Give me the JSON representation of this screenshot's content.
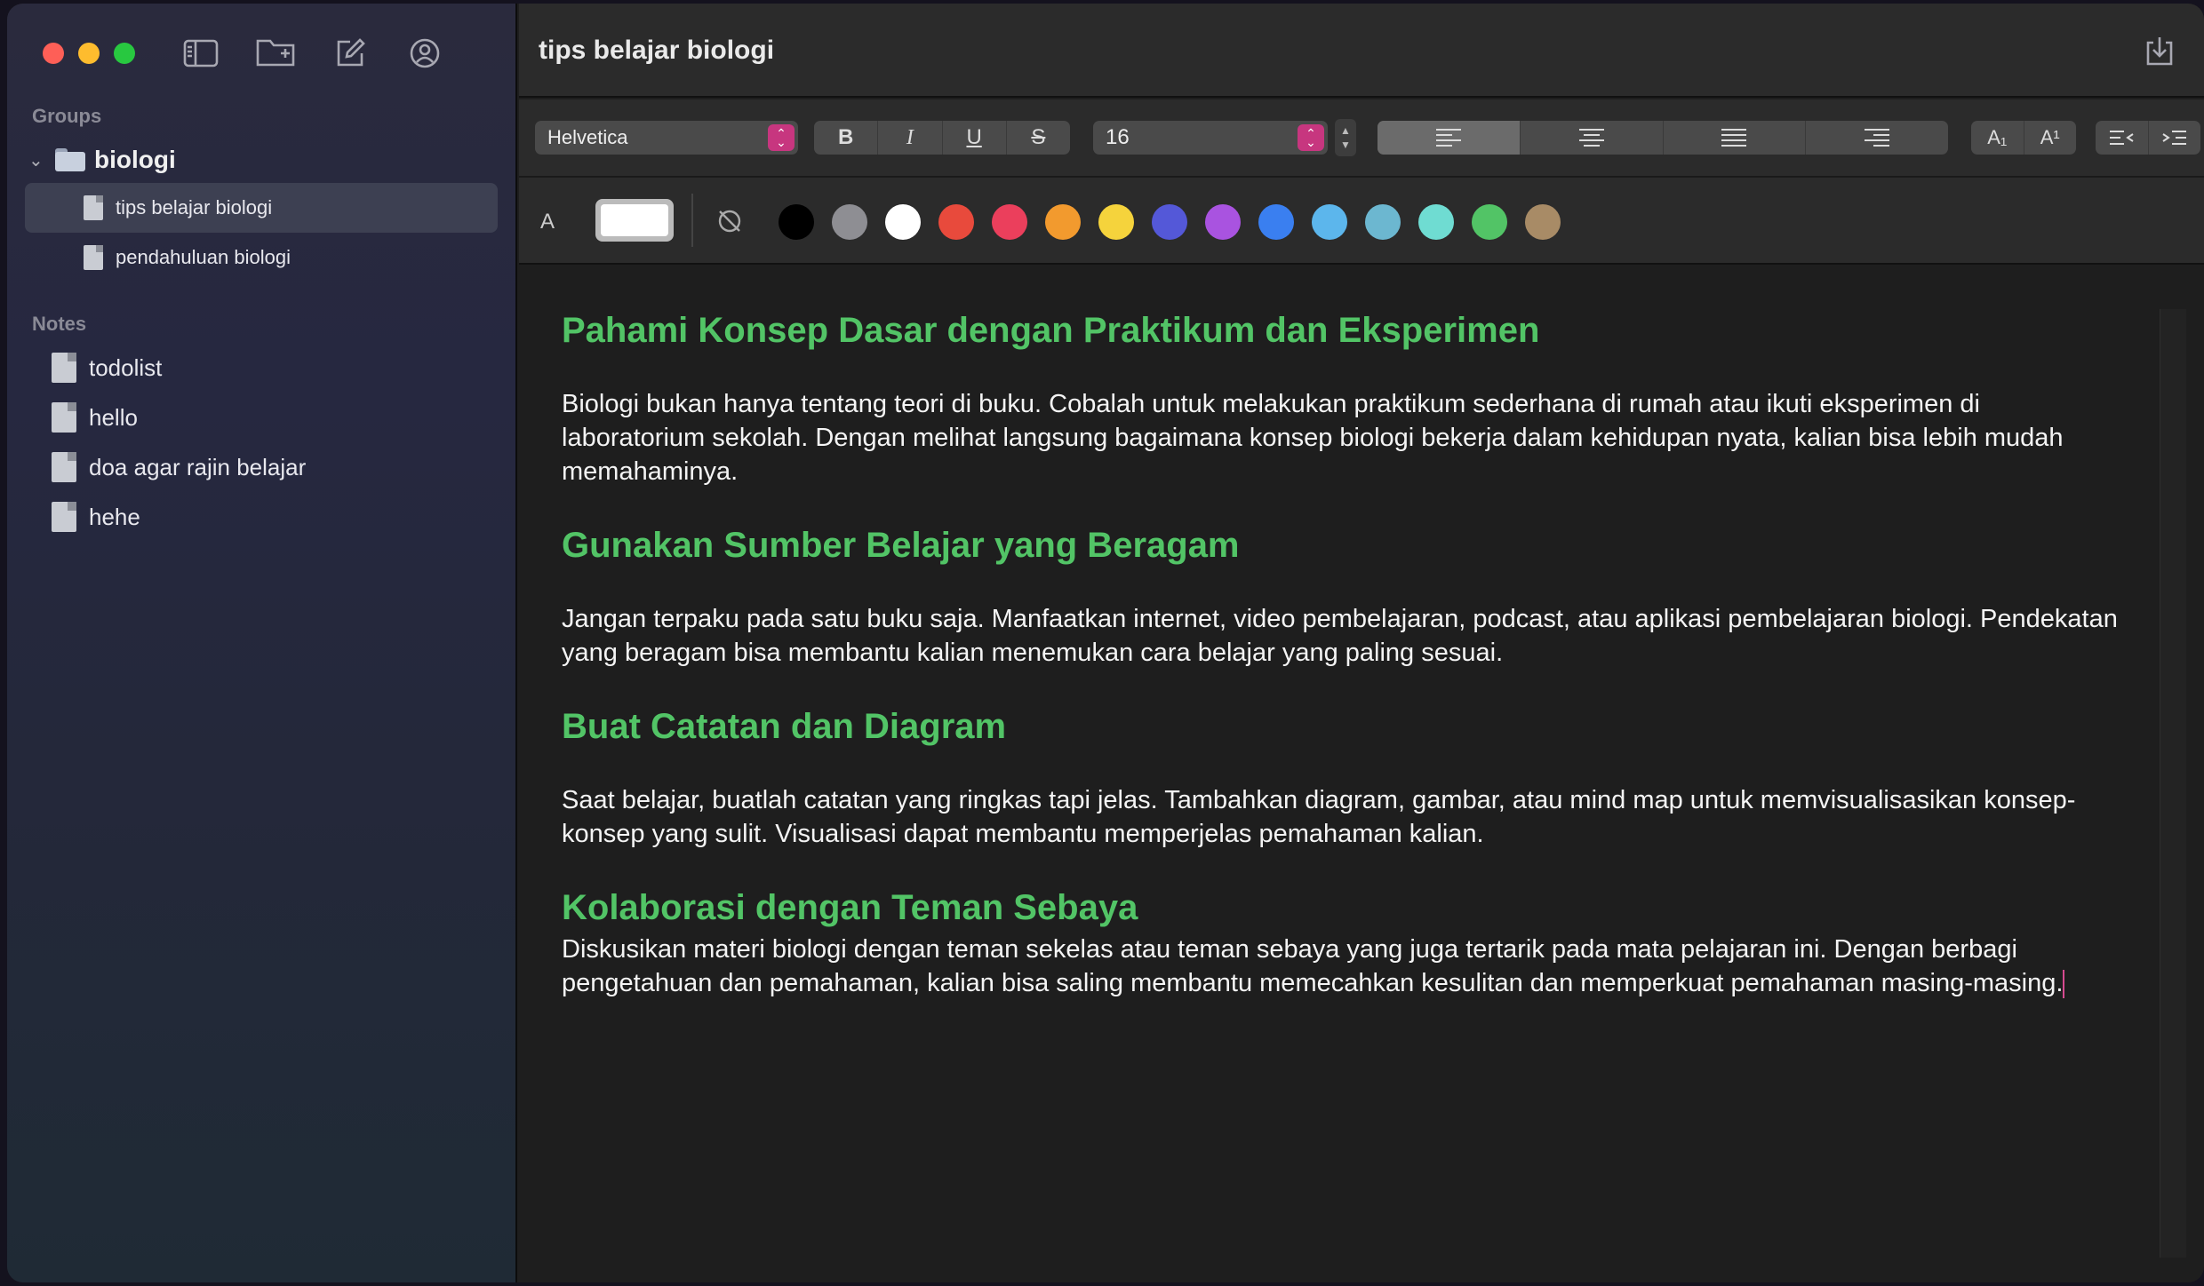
{
  "sidebar": {
    "groups_title": "Groups",
    "group": {
      "label": "biologi",
      "chevron": "chevron-down-icon",
      "icon": "folder-icon"
    },
    "group_notes": [
      {
        "label": "tips belajar biologi",
        "active": true
      },
      {
        "label": "pendahuluan biologi",
        "active": false
      }
    ],
    "notes_title": "Notes",
    "notes": [
      {
        "label": "todolist"
      },
      {
        "label": "hello"
      },
      {
        "label": "doa agar rajin belajar"
      },
      {
        "label": "hehe"
      }
    ],
    "tools": [
      "sidebar-toggle-icon",
      "new-folder-icon",
      "compose-icon",
      "account-icon"
    ]
  },
  "window_controls": {
    "close": "#fe5f57",
    "minimize": "#febc2e",
    "zoom": "#28c840"
  },
  "header": {
    "title": "tips belajar biologi",
    "export_icon": "export-icon"
  },
  "format_bar": {
    "font": "Helvetica",
    "bold": "B",
    "italic": "I",
    "underline": "U",
    "strike": "S",
    "size": "16",
    "alignment": "left",
    "subscript": "A₁",
    "superscript": "A¹"
  },
  "color_bar": {
    "label": "A",
    "current_color": "#ffffff",
    "swatches": [
      "#000000",
      "#8e8e93",
      "#ffffff",
      "#e84a3c",
      "#eb3f5c",
      "#f29a2e",
      "#f5d33c",
      "#5458d8",
      "#a953e0",
      "#3a7ff0",
      "#5cb6ec",
      "#6cb7d0",
      "#6fdcd2",
      "#52c466",
      "#a88b66"
    ]
  },
  "document": {
    "heading_color": "#52c466",
    "sections": [
      {
        "heading": "Pahami Konsep Dasar dengan Praktikum dan Eksperimen",
        "body": "Biologi bukan hanya tentang teori di buku. Cobalah untuk melakukan praktikum sederhana di rumah atau ikuti eksperimen di laboratorium sekolah. Dengan melihat langsung bagaimana konsep biologi bekerja dalam kehidupan nyata, kalian bisa lebih mudah memahaminya."
      },
      {
        "heading": "Gunakan Sumber Belajar yang Beragam",
        "body": "Jangan terpaku pada satu buku saja. Manfaatkan internet, video pembelajaran, podcast, atau aplikasi pembelajaran biologi. Pendekatan yang beragam bisa membantu kalian menemukan cara belajar yang paling sesuai."
      },
      {
        "heading": "Buat Catatan dan Diagram",
        "body": "Saat belajar, buatlah catatan yang ringkas tapi jelas. Tambahkan diagram, gambar, atau mind map untuk memvisualisasikan konsep-konsep yang sulit. Visualisasi dapat membantu memperjelas pemahaman kalian."
      },
      {
        "heading": "Kolaborasi dengan Teman Sebaya",
        "body": "Diskusikan materi biologi dengan teman sekelas atau teman sebaya yang juga tertarik pada mata pelajaran ini. Dengan berbagi pengetahuan dan pemahaman, kalian bisa saling membantu memecahkan kesulitan dan memperkuat pemahaman masing-masing."
      }
    ]
  }
}
